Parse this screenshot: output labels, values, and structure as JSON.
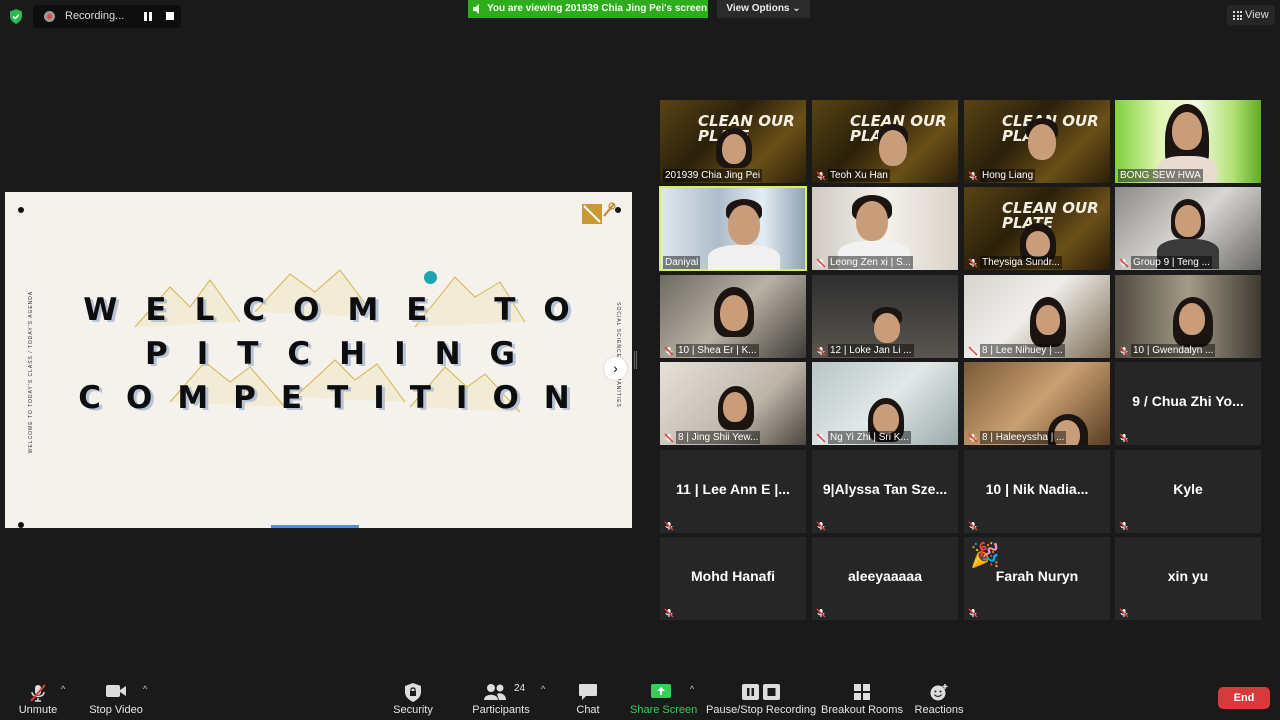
{
  "top_bar": {
    "recording_label": "Recording...",
    "viewing_banner": "You are viewing 201939 Chia Jing Pei's screen",
    "view_options_label": "View Options ⌄",
    "view_label": "View"
  },
  "slide": {
    "line1": "WELCOME TO",
    "line2": "PITCHING",
    "line3": "COMPETITION",
    "side_left_text": "WELCOME TO TODAY'S CLASS / TODAY'S AGENDA",
    "side_right_text": "SOCIAL SCIENCE & HUMANITIES",
    "logo_text": "CLEAN OUR PLATE"
  },
  "tiles": [
    {
      "name": "201939 Chia Jing Pei",
      "muted": false,
      "video": true
    },
    {
      "name": "Teoh Xu Han",
      "muted": true,
      "video": true
    },
    {
      "name": "Hong Liang",
      "muted": true,
      "video": true
    },
    {
      "name": "BONG SEW HWA",
      "muted": false,
      "video": true
    },
    {
      "name": "Daniyal",
      "muted": false,
      "video": true
    },
    {
      "name": "Leong Zen xi | S...",
      "muted": true,
      "video": true
    },
    {
      "name": "Theysiga Sundr...",
      "muted": true,
      "video": true
    },
    {
      "name": "Group 9 | Teng ...",
      "muted": true,
      "video": true
    },
    {
      "name": "10 | Shea Er | K...",
      "muted": true,
      "video": true
    },
    {
      "name": "12 | Loke Jan Li ...",
      "muted": true,
      "video": true
    },
    {
      "name": "8 | Lee Nihuey | ...",
      "muted": true,
      "video": true
    },
    {
      "name": "10 | Gwendalyn ...",
      "muted": true,
      "video": true
    },
    {
      "name": "8 | Jing Shii Yew...",
      "muted": true,
      "video": true
    },
    {
      "name": "Ng Yi Zhi | Sri K...",
      "muted": true,
      "video": true
    },
    {
      "name": "8 | Haleeyssha | ...",
      "muted": true,
      "video": true
    },
    {
      "name": "9 / Chua Zhi Yo...",
      "muted": true,
      "video": false
    },
    {
      "name": "11 | Lee Ann E |...",
      "muted": true,
      "video": false
    },
    {
      "name": "9|Alyssa Tan Sze...",
      "muted": true,
      "video": false
    },
    {
      "name": "10 | Nik Nadia...",
      "muted": true,
      "video": false
    },
    {
      "name": "Kyle",
      "muted": true,
      "video": false
    },
    {
      "name": "Mohd Hanafi",
      "muted": true,
      "video": false
    },
    {
      "name": "aleeyaaaaa",
      "muted": true,
      "video": false
    },
    {
      "name": "Farah Nuryn",
      "muted": true,
      "video": false,
      "reaction": "🎉"
    },
    {
      "name": "xin yu",
      "muted": true,
      "video": false
    }
  ],
  "toolbar": {
    "unmute": "Unmute",
    "stop_video": "Stop Video",
    "security": "Security",
    "participants": "Participants",
    "participant_count": "24",
    "chat": "Chat",
    "share_screen": "Share Screen",
    "pause_stop_recording": "Pause/Stop Recording",
    "breakout_rooms": "Breakout Rooms",
    "reactions": "Reactions",
    "end": "End"
  },
  "colors": {
    "background": "#1a1a1a",
    "banner_green": "#2ead1c",
    "active_speaker_border": "#d8ef63",
    "end_red": "#d73a3a",
    "share_green": "#2fd159"
  }
}
